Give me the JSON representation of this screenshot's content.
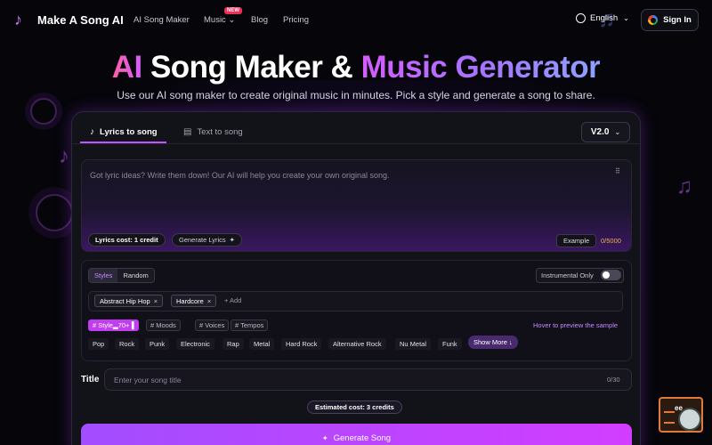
{
  "nav": {
    "logo_text": "Make A Song AI",
    "links": [
      "AI Song Maker",
      "Music",
      "Blog",
      "Pricing"
    ],
    "new_badge": "NEW",
    "language": "English",
    "signin": "Sign In"
  },
  "hero": {
    "title_ai": "AI",
    "title_mid": " Song Maker & ",
    "title_grad": "Music Generator",
    "subtitle": "Use our AI song maker to create original music in minutes. Pick a style and generate a song to share."
  },
  "tabs": [
    {
      "label": "Lyrics to song",
      "icon": "music-note-icon"
    },
    {
      "label": "Text to song",
      "icon": "document-icon"
    }
  ],
  "version": "V2.0",
  "lyrics": {
    "placeholder": "Got lyric ideas? Write them down! Our AI will help you create your own original song.",
    "cost": "Lyrics cost: 1 credit",
    "generate_lyrics": "Generate Lyrics",
    "example": "Example",
    "counter": "0/5000"
  },
  "styles": {
    "segments": [
      "Styles",
      "Random"
    ],
    "instrumental": "Instrumental Only",
    "tags": [
      "Abstract Hip Hop",
      "Hardcore"
    ],
    "add": "+ Add",
    "categories": [
      "# Style▂70+▐",
      "# Moods",
      "# Voices",
      "# Tempos"
    ],
    "hover_tip": "Hover to preview the sample",
    "genres": [
      "Pop",
      "Rock",
      "Punk",
      "Electronic",
      "Rap",
      "Metal",
      "Hard Rock",
      "Alternative Rock",
      "Nu Metal",
      "Funk"
    ],
    "show_more": "Show More ↓"
  },
  "title_field": {
    "label": "Title",
    "placeholder": "Enter your song title",
    "counter": "0/30"
  },
  "estimated": "Estimated cost: 3 credits",
  "generate_button": "Generate Song",
  "help_widget_text": "ee"
}
